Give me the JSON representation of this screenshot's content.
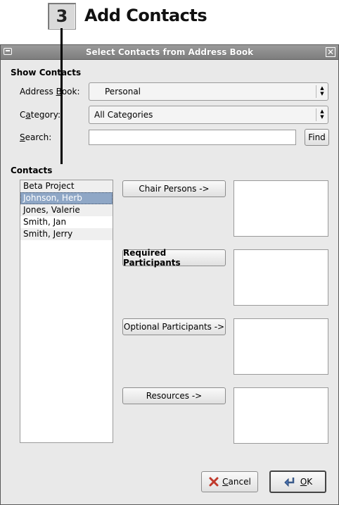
{
  "step": {
    "number": "3",
    "title": "Add Contacts"
  },
  "window": {
    "title": "Select Contacts from Address Book"
  },
  "show_contacts": {
    "heading": "Show Contacts",
    "address_book": {
      "label_pre": "Address ",
      "label_ul": "B",
      "label_post": "ook:",
      "value": "Personal"
    },
    "category": {
      "label_pre": "C",
      "label_ul": "a",
      "label_post": "tegory:",
      "value": "All Categories"
    },
    "search": {
      "label_pre": "",
      "label_ul": "S",
      "label_post": "earch:",
      "value": "",
      "find_label": "Find"
    }
  },
  "contacts": {
    "heading": "Contacts",
    "items": [
      {
        "label": "Beta Project",
        "selected": false
      },
      {
        "label": "Johnson, Herb",
        "selected": true
      },
      {
        "label": "Jones, Valerie",
        "selected": false
      },
      {
        "label": "Smith, Jan",
        "selected": false
      },
      {
        "label": "Smith, Jerry",
        "selected": false
      }
    ]
  },
  "roles": [
    {
      "label": "Chair Persons ->",
      "bold": false
    },
    {
      "label": "Required Participants",
      "bold": true
    },
    {
      "label": "Optional Participants ->",
      "bold": false
    },
    {
      "label": "Resources ->",
      "bold": false
    }
  ],
  "footer": {
    "cancel": {
      "pre": "",
      "ul": "C",
      "post": "ancel"
    },
    "ok": {
      "pre": "",
      "ul": "O",
      "post": "K"
    }
  },
  "colors": {
    "titlebar": "#8a8a8a",
    "selection": "#8fa7c6",
    "dialog_bg": "#e9e9e9",
    "cancel_icon": "#c0392b"
  }
}
